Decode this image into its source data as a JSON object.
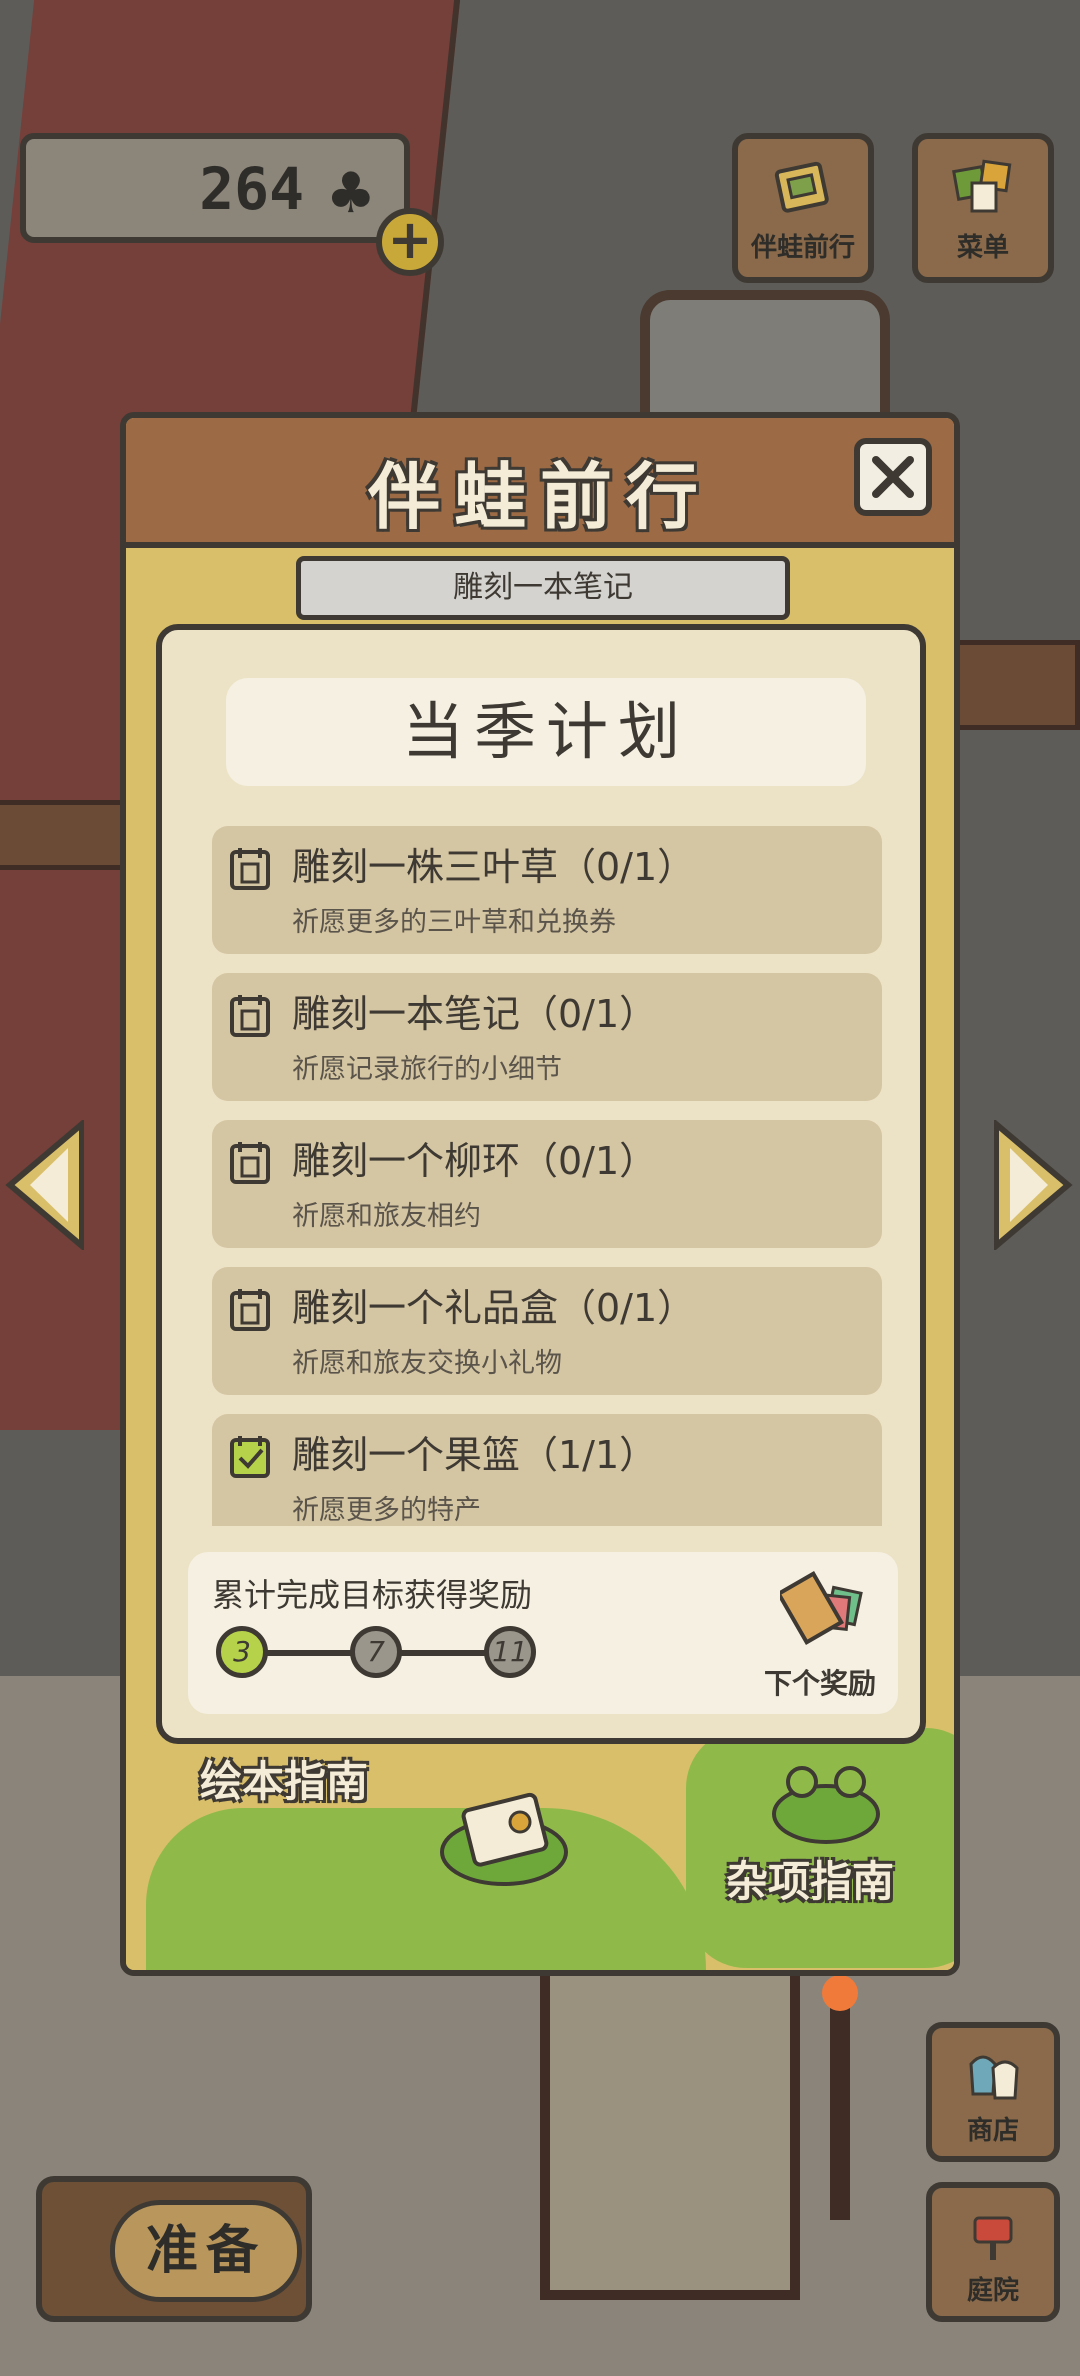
{
  "hud": {
    "clover_count": "264",
    "clover_icon": "♣",
    "plus_label": "+",
    "travel_label": "伴蛙前行",
    "menu_label": "菜单"
  },
  "modal": {
    "title": "伴蛙前行",
    "banner": "雕刻一本笔记",
    "plan_title": "当季计划",
    "tasks": [
      {
        "name": "雕刻一株三叶草（0/1）",
        "desc": "祈愿更多的三叶草和兑换券",
        "done": false
      },
      {
        "name": "雕刻一本笔记（0/1）",
        "desc": "祈愿记录旅行的小细节",
        "done": false
      },
      {
        "name": "雕刻一个柳环（0/1）",
        "desc": "祈愿和旅友相约",
        "done": false
      },
      {
        "name": "雕刻一个礼品盒（0/1）",
        "desc": "祈愿和旅友交换小礼物",
        "done": false
      },
      {
        "name": "雕刻一个果篮（1/1）",
        "desc": "祈愿更多的特产",
        "done": true
      }
    ],
    "reward": {
      "text": "累计完成目标获得奖励",
      "milestones": [
        "3",
        "7",
        "11"
      ],
      "next_label": "下个奖励"
    },
    "guides": {
      "picture_book": "绘本指南",
      "misc": "杂项指南"
    }
  },
  "bottom": {
    "ready_label": "准备",
    "shop_label": "商店",
    "yard_label": "庭院"
  },
  "colors": {
    "wood_dark": "#3e3a33",
    "header_brown": "#9c6a45",
    "frame_gold": "#d9bf6a",
    "panel_cream": "#ece2c6",
    "task_bg": "#d5c6a3",
    "milestone_done": "#b6d24a",
    "milestone_pending": "#9a968c",
    "grass_green": "#8fba4a"
  }
}
